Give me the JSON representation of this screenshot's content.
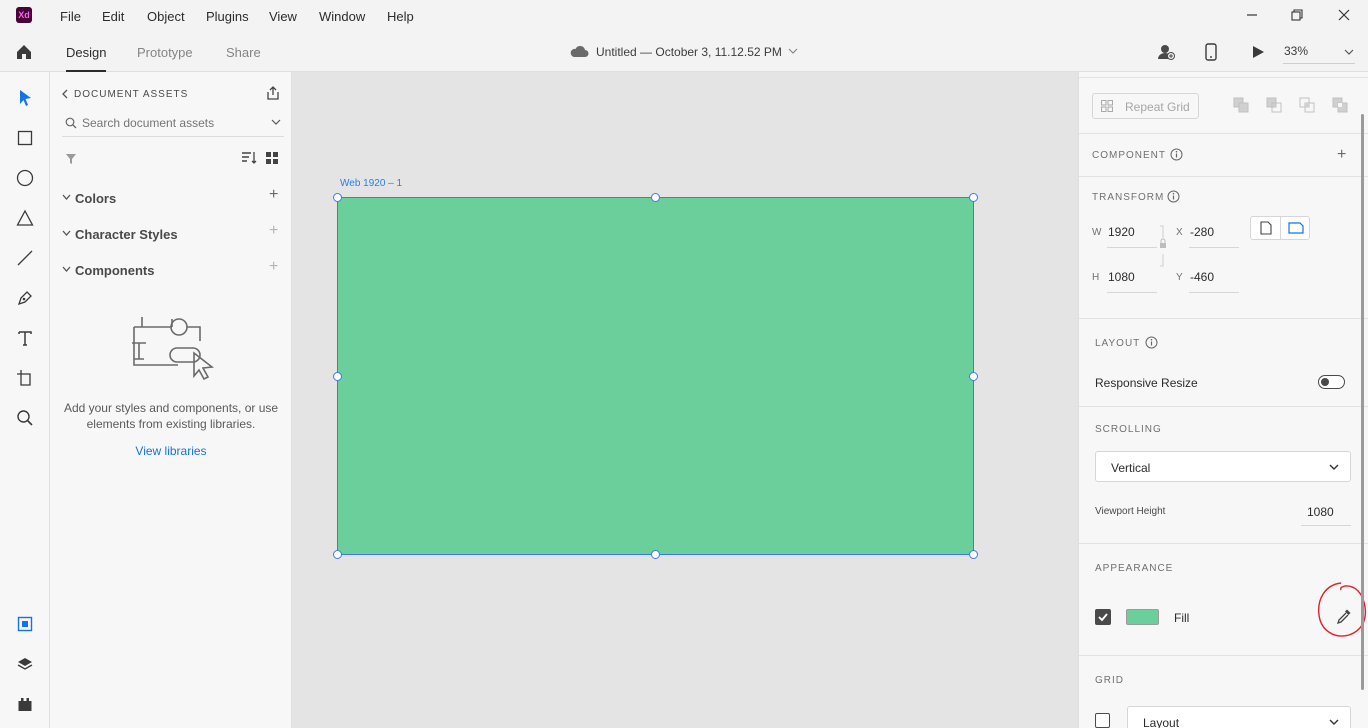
{
  "app": {
    "logo_text": "Xd"
  },
  "menu": [
    "File",
    "Edit",
    "Object",
    "Plugins",
    "View",
    "Window",
    "Help"
  ],
  "tabs": [
    "Design",
    "Prototype",
    "Share"
  ],
  "document": {
    "title": "Untitled — October 3, 11.12.52 PM"
  },
  "zoom": "33%",
  "assets": {
    "header": "DOCUMENT ASSETS",
    "search_placeholder": "Search document assets",
    "sections": [
      "Colors",
      "Character Styles",
      "Components"
    ],
    "empty_text": "Add your styles and components, or use elements from existing libraries.",
    "view_libraries": "View libraries"
  },
  "canvas": {
    "artboard_name": "Web 1920 – 1",
    "artboard_color": "#6bcf9c"
  },
  "inspector": {
    "repeat_grid": "Repeat Grid",
    "component": "COMPONENT",
    "transform": "TRANSFORM",
    "w_label": "W",
    "w_value": "1920",
    "x_label": "X",
    "x_value": "-280",
    "h_label": "H",
    "h_value": "1080",
    "y_label": "Y",
    "y_value": "-460",
    "layout": "LAYOUT",
    "responsive_resize": "Responsive Resize",
    "scrolling": "SCROLLING",
    "scrolling_value": "Vertical",
    "viewport_height_label": "Viewport Height",
    "viewport_height_value": "1080",
    "appearance": "APPEARANCE",
    "fill_label": "Fill",
    "fill_color": "#6bcf9c",
    "grid": "GRID",
    "grid_value": "Layout"
  }
}
